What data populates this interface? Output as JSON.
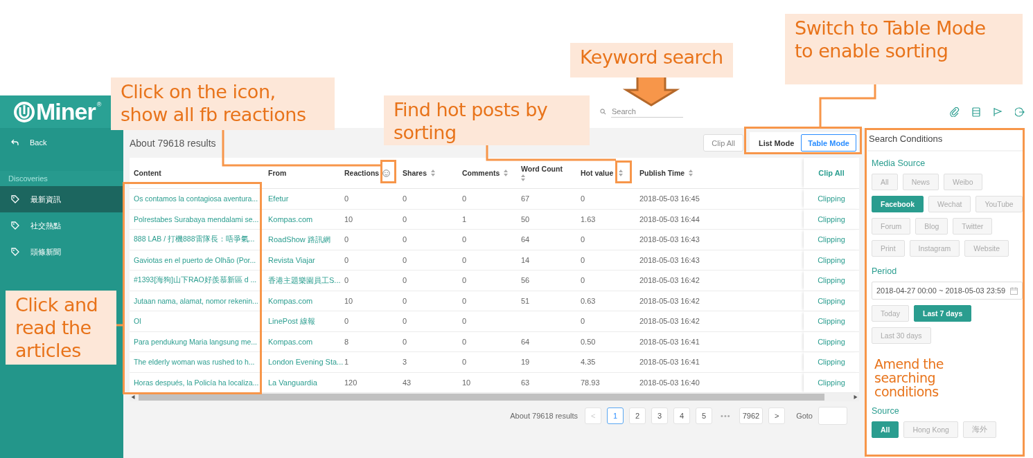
{
  "sidebar": {
    "logo": "Miner",
    "logo_mark": "®",
    "back": "Back",
    "section": "Discoveries",
    "items": [
      {
        "label": "最新資訊",
        "selected": true
      },
      {
        "label": "社交熱點",
        "selected": false
      },
      {
        "label": "頭條新聞",
        "selected": false
      }
    ]
  },
  "header": {
    "search": {
      "placeholder": "Search"
    }
  },
  "toolbar": {
    "results": "About 79618 results",
    "clip_all": "Clip All",
    "modes": [
      {
        "label": "List Mode",
        "selected": false
      },
      {
        "label": "Table Mode",
        "selected": true
      }
    ]
  },
  "table": {
    "columns": [
      {
        "label": "Content",
        "kind": "text"
      },
      {
        "label": "From",
        "kind": "text"
      },
      {
        "label": "Reactions",
        "kind": "reactions"
      },
      {
        "label": "Shares",
        "kind": "sortable"
      },
      {
        "label": "Comments",
        "kind": "sortable"
      },
      {
        "label": "Word Count",
        "kind": "sortable"
      },
      {
        "label": "Hot value",
        "kind": "sortable"
      },
      {
        "label": "Publish Time",
        "kind": "sortable"
      },
      {
        "label": "Clip All",
        "kind": "action"
      }
    ],
    "rows": [
      {
        "content": "Os contamos la contagiosa aventura...",
        "from": "Efetur",
        "reactions": "0",
        "shares": "0",
        "comments": "0",
        "word_count": "67",
        "hot_value": "0",
        "publish_time": "2018-05-03 16:45",
        "action": "Clipping"
      },
      {
        "content": "Polrestabes Surabaya mendalami se...",
        "from": "Kompas.com",
        "reactions": "10",
        "shares": "0",
        "comments": "1",
        "word_count": "50",
        "hot_value": "1.63",
        "publish_time": "2018-05-03 16:44",
        "action": "Clipping"
      },
      {
        "content": "888 LAB / 打機888雷隊長：唔爭氣...",
        "from": "RoadShow 路訊網",
        "reactions": "0",
        "shares": "0",
        "comments": "0",
        "word_count": "64",
        "hot_value": "0",
        "publish_time": "2018-05-03 16:43",
        "action": "Clipping"
      },
      {
        "content": "Gaviotas en el puerto de Olhão (Por...",
        "from": "Revista Viajar",
        "reactions": "0",
        "shares": "0",
        "comments": "0",
        "word_count": "14",
        "hot_value": "0",
        "publish_time": "2018-05-03 16:43",
        "action": "Clipping"
      },
      {
        "content": "#1393[海狗]山下RAO好羨慕新區 d ...",
        "from": "香港主題樂園員工S...",
        "reactions": "0",
        "shares": "0",
        "comments": "0",
        "word_count": "56",
        "hot_value": "0",
        "publish_time": "2018-05-03 16:42",
        "action": "Clipping"
      },
      {
        "content": "Jutaan nama, alamat, nomor rekenin...",
        "from": "Kompas.com",
        "reactions": "10",
        "shares": "0",
        "comments": "0",
        "word_count": "51",
        "hot_value": "0.63",
        "publish_time": "2018-05-03 16:42",
        "action": "Clipping"
      },
      {
        "content": "Ol",
        "from": "LinePost 線報",
        "reactions": "0",
        "shares": "0",
        "comments": "0",
        "hot_value": "0",
        "publish_time": "2018-05-03 16:42",
        "action": "Clipping"
      },
      {
        "content": "Para pendukung Maria langsung me...",
        "from": "Kompas.com",
        "reactions": "8",
        "shares": "0",
        "comments": "0",
        "word_count": "64",
        "hot_value": "0.50",
        "publish_time": "2018-05-03 16:41",
        "action": "Clipping"
      },
      {
        "content": "The elderly woman was rushed to h...",
        "from": "London Evening Sta...",
        "reactions": "1",
        "shares": "3",
        "comments": "0",
        "word_count": "19",
        "hot_value": "4.35",
        "publish_time": "2018-05-03 16:41",
        "action": "Clipping"
      },
      {
        "content": "Horas después, la Policía ha localiza...",
        "from": "La Vanguardia",
        "reactions": "120",
        "shares": "43",
        "comments": "10",
        "word_count": "63",
        "hot_value": "78.93",
        "publish_time": "2018-05-03 16:40",
        "action": "Clipping"
      }
    ]
  },
  "pagination": {
    "summary": "About 79618 results",
    "prev": "<",
    "pages": [
      {
        "label": "1",
        "selected": true
      },
      {
        "label": "2",
        "selected": false
      },
      {
        "label": "3",
        "selected": false
      },
      {
        "label": "4",
        "selected": false
      },
      {
        "label": "5",
        "selected": false
      }
    ],
    "ellipsis": "•••",
    "last": "7962",
    "next": ">",
    "goto": "Goto"
  },
  "conditions": {
    "title": "Search Conditions",
    "groups": [
      {
        "label": "Media Source",
        "chips": [
          {
            "label": "All",
            "selected": false
          },
          {
            "label": "News",
            "selected": false
          },
          {
            "label": "Weibo",
            "selected": false
          },
          {
            "label": "Facebook",
            "selected": true
          },
          {
            "label": "Wechat",
            "selected": false
          },
          {
            "label": "YouTube",
            "selected": false
          },
          {
            "label": "Forum",
            "selected": false
          },
          {
            "label": "Blog",
            "selected": false
          },
          {
            "label": "Twitter",
            "selected": false
          },
          {
            "label": "Print",
            "selected": false
          },
          {
            "label": "Instagram",
            "selected": false
          },
          {
            "label": "Website",
            "selected": false
          }
        ]
      },
      {
        "label": "Period",
        "field": "2018-04-27 00:00 ~ 2018-05-03 23:59",
        "chips": [
          {
            "label": "Today",
            "selected": false
          },
          {
            "label": "Last 7 days",
            "selected": true
          },
          {
            "label": "Last 30 days",
            "selected": false
          }
        ]
      },
      {
        "label": "Source",
        "chips": [
          {
            "label": "All",
            "selected": true
          },
          {
            "label": "Hong Kong",
            "selected": false
          },
          {
            "label": "海外",
            "selected": false
          }
        ]
      }
    ]
  },
  "annotations": [
    {
      "kind": "callout",
      "text": "Click on the icon,\nshow all fb reactions"
    },
    {
      "kind": "callout",
      "text": "Find hot posts by\nsorting"
    },
    {
      "kind": "callout",
      "text": "Keyword search"
    },
    {
      "kind": "callout",
      "text": "Switch to Table Mode\nto enable sorting"
    },
    {
      "kind": "label",
      "text": "Click and\nread the\narticles"
    },
    {
      "kind": "label",
      "text": "Amend the\nsearching\nconditions"
    }
  ]
}
